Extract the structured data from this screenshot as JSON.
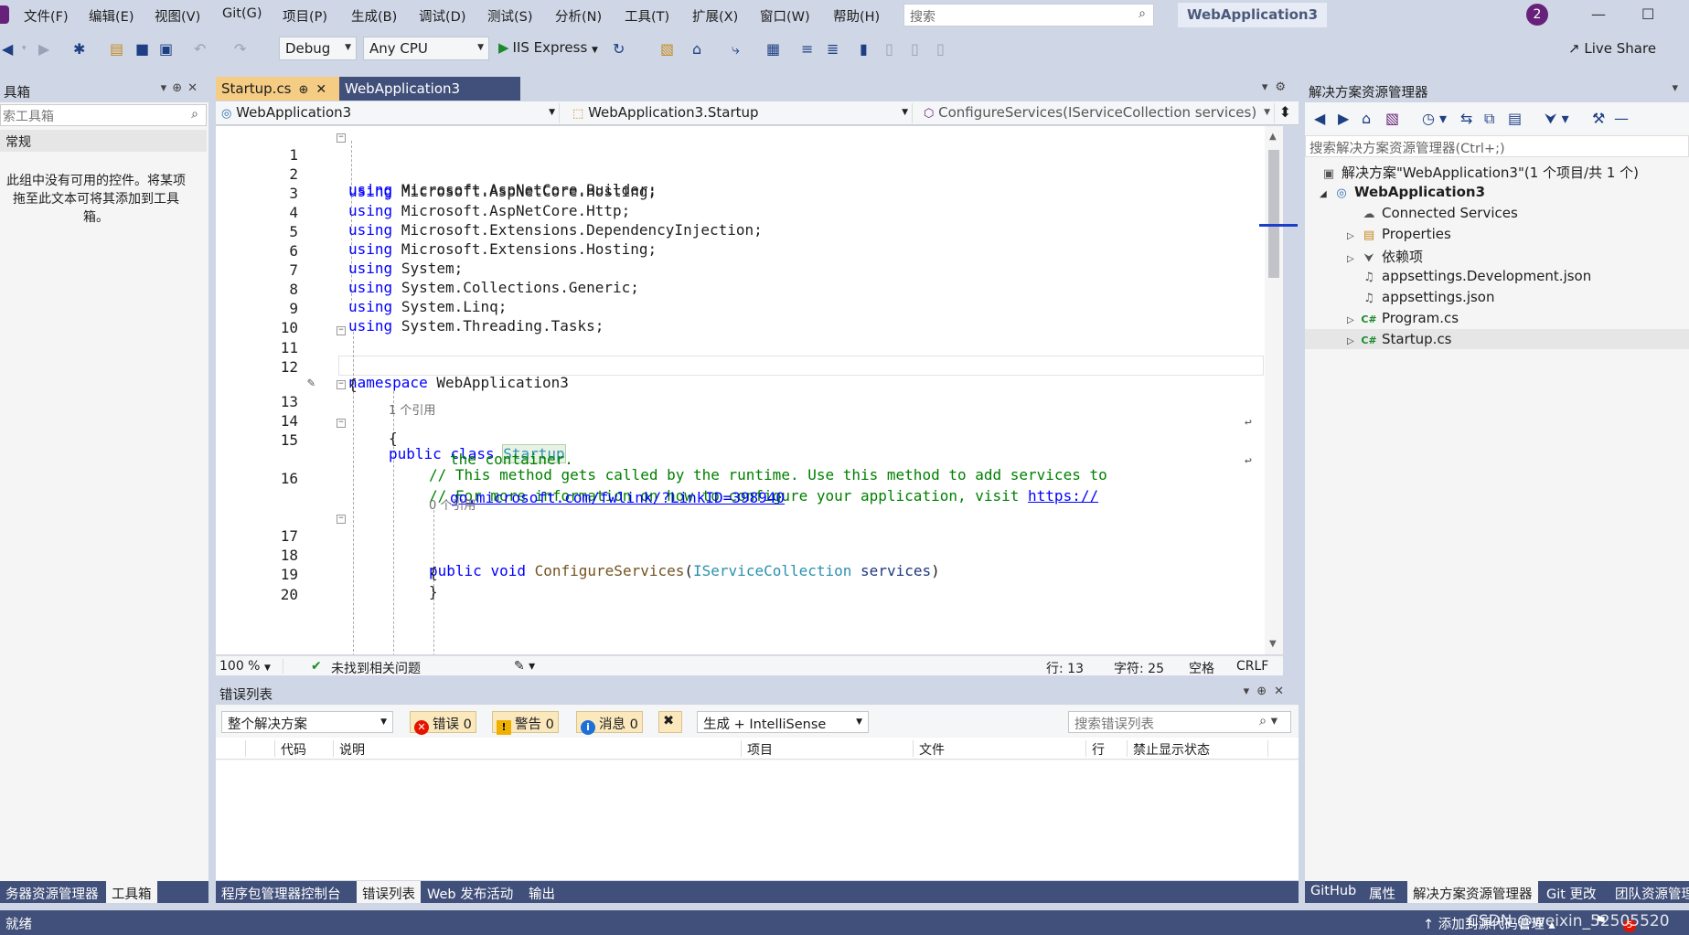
{
  "menu": {
    "items": [
      "文件(F)",
      "编辑(E)",
      "视图(V)",
      "Git(G)",
      "项目(P)",
      "生成(B)",
      "调试(D)",
      "测试(S)",
      "分析(N)",
      "工具(T)",
      "扩展(X)",
      "窗口(W)",
      "帮助(H)"
    ],
    "search_placeholder": "搜索",
    "solution_title": "WebApplication3",
    "notification_count": "2"
  },
  "toolbar": {
    "configuration": "Debug",
    "platform": "Any CPU",
    "run_target": "IIS Express",
    "live_share": "Live Share"
  },
  "toolbox": {
    "title": "具箱",
    "search_placeholder": "索工具箱",
    "group": "常规",
    "empty_lines": [
      "此组中没有可用的控件。将某项",
      "拖至此文本可将其添加到工具",
      "箱。"
    ]
  },
  "left_tabs": [
    "务器资源管理器",
    "工具箱"
  ],
  "doc_tabs": {
    "active": "Startup.cs",
    "inactive": "WebApplication3"
  },
  "nav": {
    "project": "WebApplication3",
    "type": "WebApplication3.Startup",
    "member": "ConfigureServices(IServiceCollection services)"
  },
  "code": {
    "usings": [
      "Microsoft.AspNetCore.Builder;",
      "Microsoft.AspNetCore.Hosting;",
      "Microsoft.AspNetCore.Http;",
      "Microsoft.Extensions.DependencyInjection;",
      "Microsoft.Extensions.Hosting;",
      "System;",
      "System.Collections.Generic;",
      "System.Linq;",
      "System.Threading.Tasks;"
    ],
    "kw_using": "using",
    "kw_namespace": "namespace",
    "namespace_name": "WebApplication3",
    "brace_open": "{",
    "brace_close": "}",
    "refs_class": "1 个引用",
    "kw_public": "public",
    "kw_class": "class",
    "class_name": "Startup",
    "comment1a": "// This method gets called by the runtime. Use this method to add services to",
    "comment1b": "the container.",
    "comment2a": "// For more information on how to configure your application, visit ",
    "link_a": "https://",
    "link_b": "go.microsoft.com/fwlink/?LinkID=398940",
    "refs_method": "0 个引用",
    "kw_void": "void",
    "method_name": "ConfigureServices",
    "param_type": "IServiceCollection",
    "param_name": "services",
    "line_numbers": [
      "1",
      "2",
      "3",
      "4",
      "5",
      "6",
      "7",
      "8",
      "9",
      "10",
      "11",
      "12",
      "13",
      "14",
      "15",
      "16",
      "17",
      "18",
      "19",
      "20"
    ]
  },
  "editor_status": {
    "zoom": "100 %",
    "issues": "未找到相关问题",
    "line": "行: 13",
    "char": "字符: 25",
    "whitespace": "空格",
    "eol": "CRLF"
  },
  "error_list": {
    "title": "错误列表",
    "scope": "整个解决方案",
    "errors": "错误 0",
    "warnings": "警告 0",
    "messages": "消息 0",
    "source": "生成 + IntelliSense",
    "search_placeholder": "搜索错误列表",
    "columns": [
      "代码",
      "说明",
      "项目",
      "文件",
      "行",
      "禁止显示状态"
    ]
  },
  "center_tabs": [
    "程序包管理器控制台",
    "错误列表",
    "Web 发布活动",
    "输出"
  ],
  "solution_explorer": {
    "title": "解决方案资源管理器",
    "search_placeholder": "搜索解决方案资源管理器(Ctrl+;)",
    "solution_node": "解决方案\"WebApplication3\"(1 个项目/共 1 个)",
    "project_node": "WebApplication3",
    "items": [
      "Connected Services",
      "Properties",
      "依赖项",
      "appsettings.Development.json",
      "appsettings.json",
      "Program.cs",
      "Startup.cs"
    ]
  },
  "right_tabs": [
    "GitHub",
    "属性",
    "解决方案资源管理器",
    "Git 更改",
    "团队资源管理"
  ],
  "status": {
    "ready": "就绪",
    "source_control": "添加到源代码管理",
    "badge": "5",
    "watermark": "CSDN @weixin_52505520"
  }
}
